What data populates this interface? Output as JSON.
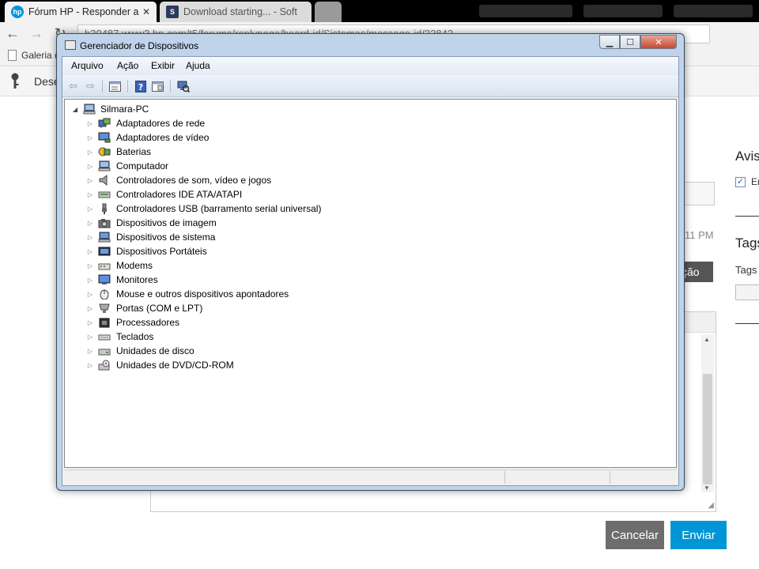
{
  "browser": {
    "tabs": [
      {
        "title": "Fórum HP - Responder a r",
        "favicon": "hp",
        "active": true
      },
      {
        "title": "Download starting... - Soft",
        "favicon": "S",
        "active": false
      },
      {
        "title": "",
        "favicon": "",
        "active": false
      }
    ],
    "url": "h30487.www3.hp.com/t5/forums/replypage/board-id/Sistemas/message-id/22842",
    "bookmarks": [
      {
        "label": "Galeria d"
      }
    ],
    "forum_toolbar_label": "Dese"
  },
  "page": {
    "right_panel_title": "Avis",
    "checkbox_label": "Em re",
    "time_text": "11 PM",
    "dark_button_text": "ção",
    "tags_title": "Tags",
    "tags_label": "Tags",
    "cancel_button": "Cancelar",
    "send_button": "Enviar"
  },
  "device_manager": {
    "title": "Gerenciador de Dispositivos",
    "menu": [
      "Arquivo",
      "Ação",
      "Exibir",
      "Ajuda"
    ],
    "toolbar_icons": [
      "back-icon",
      "forward-icon",
      "properties-icon",
      "help-icon",
      "show-hide-icon",
      "scan-hardware-icon"
    ],
    "root": "Silmara-PC",
    "devices": [
      {
        "label": "Adaptadores de rede",
        "icon": "network-adapter-icon"
      },
      {
        "label": "Adaptadores de vídeo",
        "icon": "display-adapter-icon"
      },
      {
        "label": "Baterias",
        "icon": "battery-icon"
      },
      {
        "label": "Computador",
        "icon": "computer-icon"
      },
      {
        "label": "Controladores de som, vídeo e jogos",
        "icon": "speaker-icon"
      },
      {
        "label": "Controladores IDE ATA/ATAPI",
        "icon": "ide-controller-icon"
      },
      {
        "label": "Controladores USB (barramento serial universal)",
        "icon": "usb-icon"
      },
      {
        "label": "Dispositivos de imagem",
        "icon": "camera-icon"
      },
      {
        "label": "Dispositivos de sistema",
        "icon": "system-device-icon"
      },
      {
        "label": "Dispositivos Portáteis",
        "icon": "portable-device-icon"
      },
      {
        "label": "Modems",
        "icon": "modem-icon"
      },
      {
        "label": "Monitores",
        "icon": "monitor-icon"
      },
      {
        "label": "Mouse e outros dispositivos apontadores",
        "icon": "mouse-icon"
      },
      {
        "label": "Portas (COM e LPT)",
        "icon": "port-icon"
      },
      {
        "label": "Processadores",
        "icon": "processor-icon"
      },
      {
        "label": "Teclados",
        "icon": "keyboard-icon"
      },
      {
        "label": "Unidades de disco",
        "icon": "disk-drive-icon"
      },
      {
        "label": "Unidades de DVD/CD-ROM",
        "icon": "dvd-drive-icon"
      }
    ]
  },
  "colors": {
    "hp_blue": "#0096d6",
    "cancel_gray": "#6d6d6d",
    "close_red": "#c44a32",
    "window_frame": "#bfd3ea"
  }
}
